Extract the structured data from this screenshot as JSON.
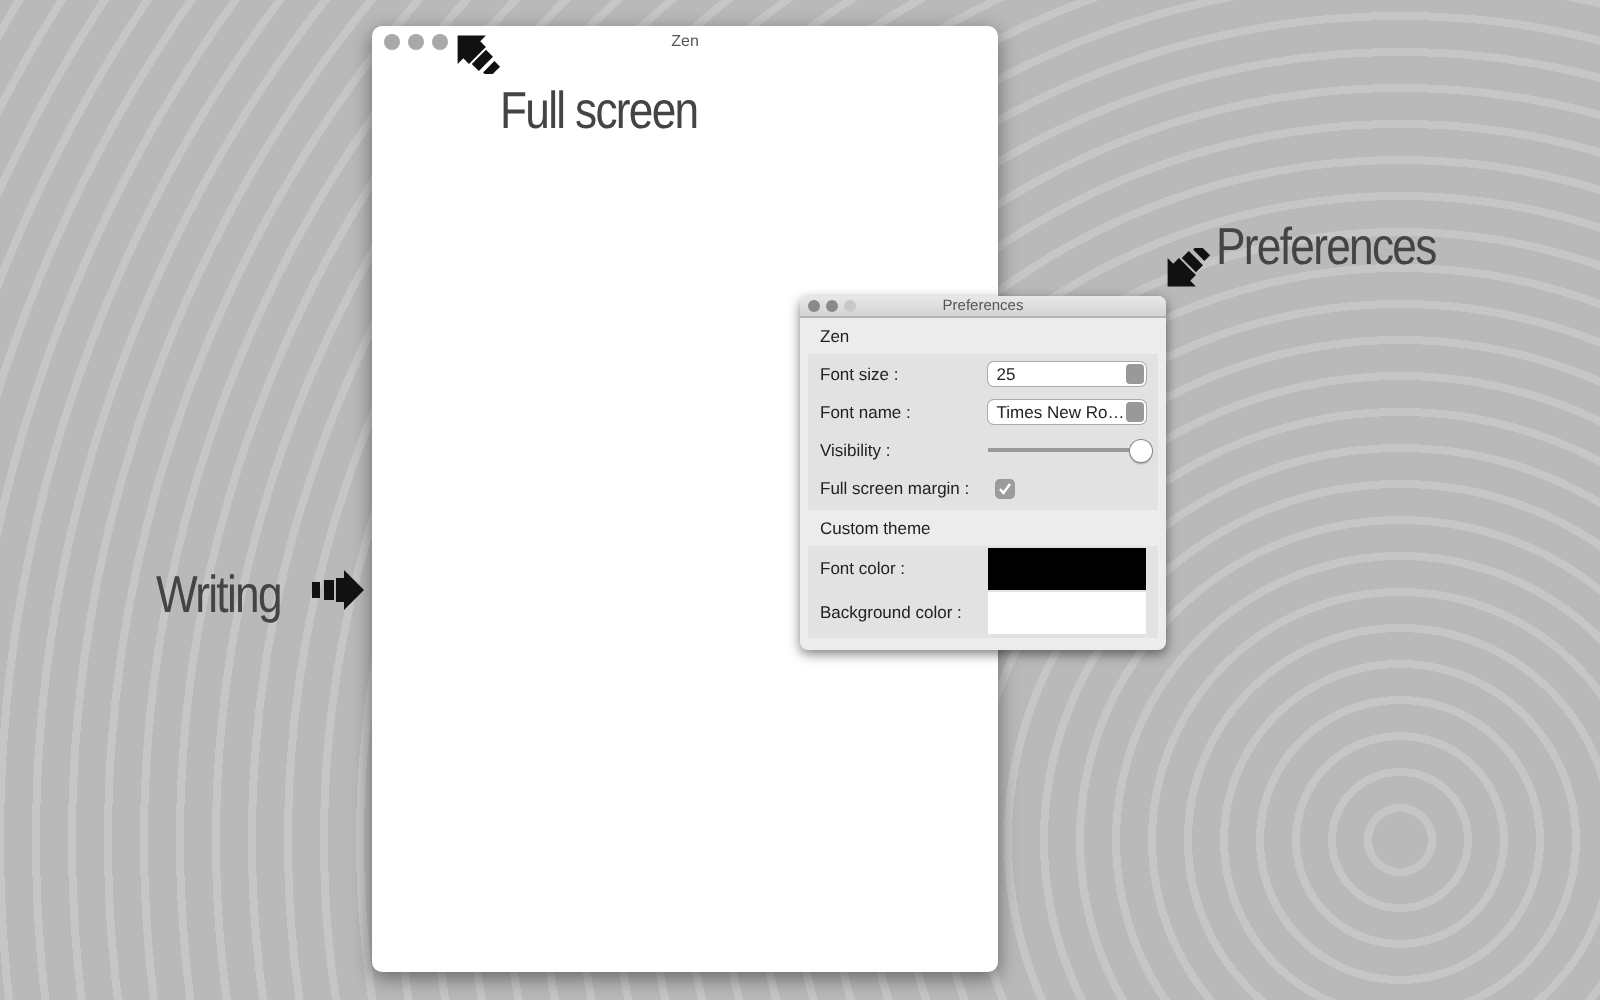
{
  "annotations": [
    {
      "text": "Full screen",
      "kind": "up-left"
    },
    {
      "text": "Preferences",
      "kind": "down-left"
    },
    {
      "text": "Writing",
      "kind": "right"
    }
  ],
  "editor_window": {
    "title": "Zen"
  },
  "preferences_window": {
    "title": "Preferences",
    "sections": [
      {
        "title": "Zen",
        "rows": [
          {
            "kind": "stepper",
            "label": "Font size :",
            "value": "25"
          },
          {
            "kind": "popup",
            "label": "Font name :",
            "value": "Times New Ro…"
          },
          {
            "kind": "slider",
            "label": "Visibility :",
            "level": 1.0
          },
          {
            "kind": "checkbox",
            "label": "Full screen margin :",
            "checked": true
          }
        ]
      },
      {
        "title": "Custom theme",
        "rows": [
          {
            "kind": "color",
            "label": "Font color :",
            "color": "#000000"
          },
          {
            "kind": "color",
            "label": "Background color :",
            "color": "#ffffff"
          }
        ]
      }
    ]
  }
}
